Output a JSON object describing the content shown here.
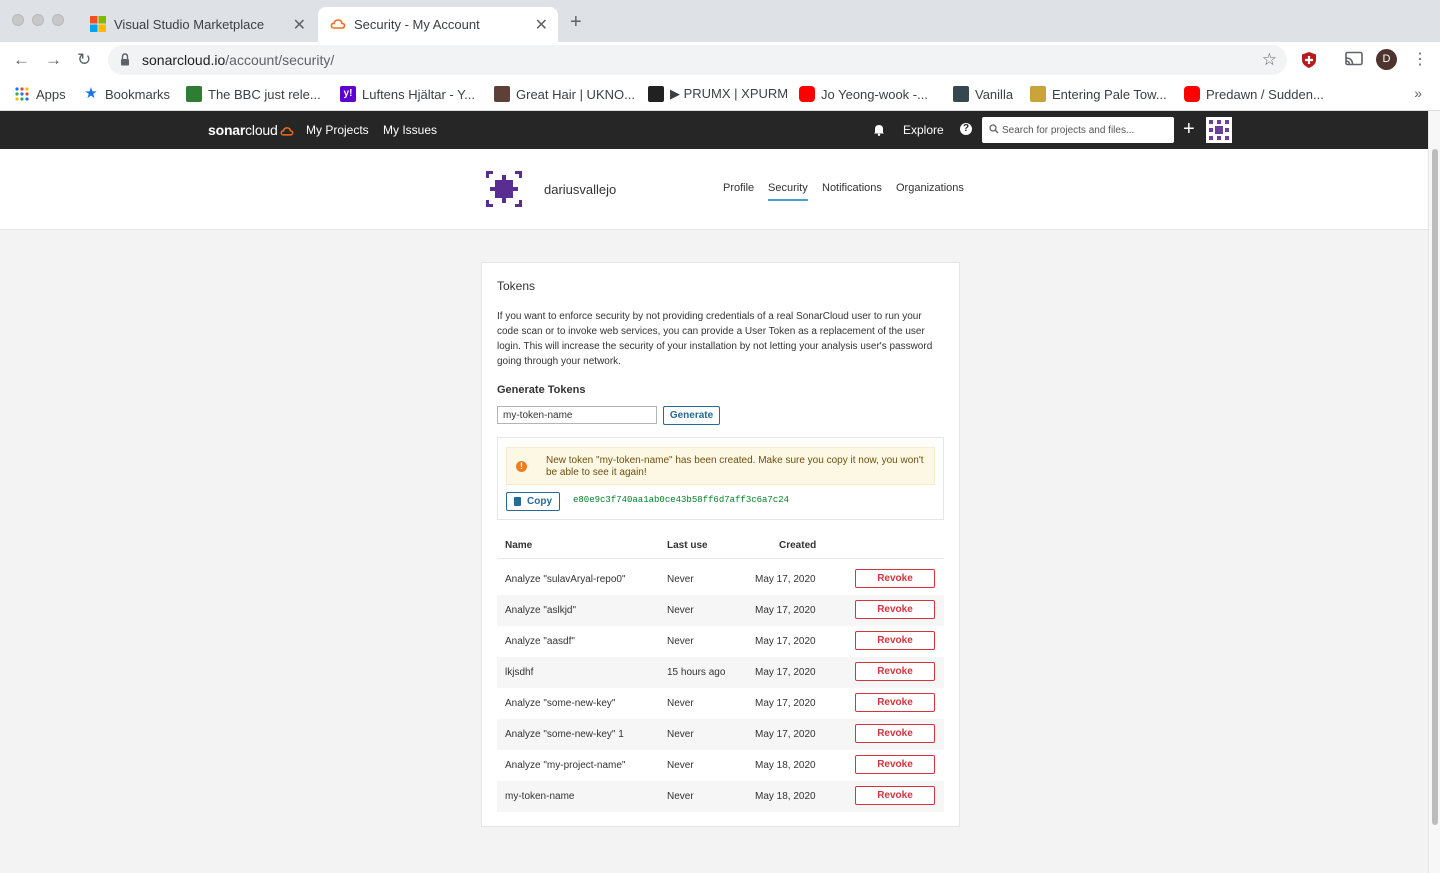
{
  "browser": {
    "tabs": [
      {
        "title": "Visual Studio Marketplace",
        "active": false
      },
      {
        "title": "Security - My Account",
        "active": true
      }
    ],
    "url_host": "sonarcloud.io",
    "url_path": "/account/security/",
    "profile_initial": "D",
    "bookmarks": [
      "Apps",
      "Bookmarks",
      "The BBC just rele...",
      "Luftens Hjältar - Y...",
      "Great Hair | UKNO...",
      "▶ PRUMX | XPURM",
      "Jo Yeong-wook -...",
      "Vanilla",
      "Entering Pale Tow...",
      "Predawn / Sudden..."
    ],
    "bookmarks_more": "»"
  },
  "topnav": {
    "logo_bold": "sonar",
    "logo_light": "cloud",
    "my_projects": "My Projects",
    "my_issues": "My Issues",
    "explore": "Explore",
    "help": "?",
    "search_placeholder": "Search for projects and files...",
    "plus": "+"
  },
  "account": {
    "username": "dariusvallejo",
    "tabs": [
      "Profile",
      "Security",
      "Notifications",
      "Organizations"
    ],
    "active_tab": "Security"
  },
  "tokens": {
    "title": "Tokens",
    "description": "If you want to enforce security by not providing credentials of a real SonarCloud user to run your code scan or to invoke web services, you can provide a User Token as a replacement of the user login. This will increase the security of your installation by not letting your analysis user's password going through your network.",
    "generate_title": "Generate Tokens",
    "input_value": "my-token-name",
    "generate_label": "Generate",
    "warning": "New token \"my-token-name\" has been created. Make sure you copy it now, you won't be able to see it again!",
    "copy_label": "Copy",
    "token_value": "e80e9c3f740aa1ab0ce43b58ff6d7aff3c6a7c24",
    "columns": {
      "name": "Name",
      "last_use": "Last use",
      "created": "Created"
    },
    "revoke_label": "Revoke",
    "rows": [
      {
        "name": "Analyze \"sulavAryal-repo0\"",
        "last_use": "Never",
        "created": "May 17, 2020"
      },
      {
        "name": "Analyze \"aslkjd\"",
        "last_use": "Never",
        "created": "May 17, 2020"
      },
      {
        "name": "Analyze \"aasdf\"",
        "last_use": "Never",
        "created": "May 17, 2020"
      },
      {
        "name": "lkjsdhf",
        "last_use": "15 hours ago",
        "created": "May 17, 2020"
      },
      {
        "name": "Analyze \"some-new-key\"",
        "last_use": "Never",
        "created": "May 17, 2020"
      },
      {
        "name": "Analyze \"some-new-key\" 1",
        "last_use": "Never",
        "created": "May 17, 2020"
      },
      {
        "name": "Analyze \"my-project-name\"",
        "last_use": "Never",
        "created": "May 18, 2020"
      },
      {
        "name": "my-token-name",
        "last_use": "Never",
        "created": "May 18, 2020"
      }
    ]
  },
  "colors": {
    "accent": "#4b9fd5",
    "button_blue": "#236a97",
    "danger": "#d4333f",
    "token_green": "#008223",
    "nav_bg": "#262626"
  }
}
